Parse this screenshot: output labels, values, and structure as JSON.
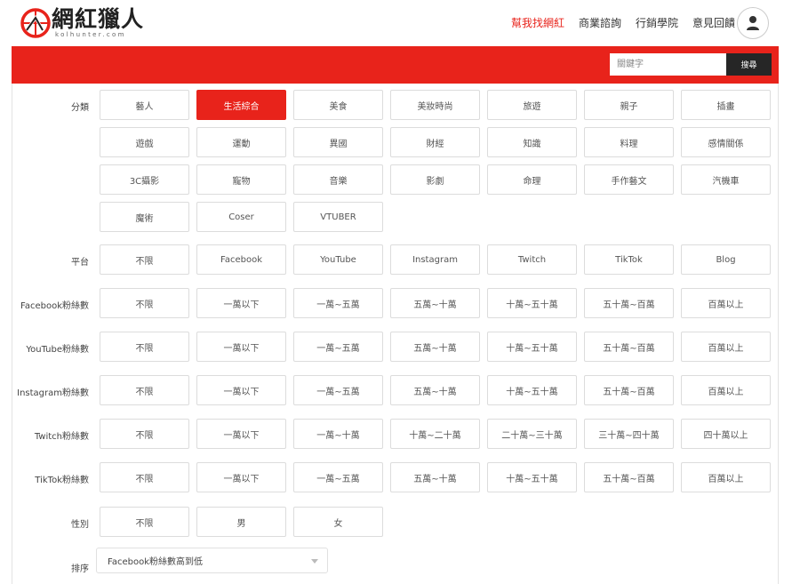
{
  "brand": {
    "name": "網紅獵人",
    "sub": "kolhunter.com"
  },
  "nav": [
    "幫我找網紅",
    "商業諮詢",
    "行銷學院",
    "意見回饋"
  ],
  "search": {
    "placeholder": "關鍵字",
    "button": "搜尋"
  },
  "colors": {
    "accent": "#e8231b",
    "button_dark": "#262626"
  },
  "filters": [
    {
      "label": "分類",
      "options": [
        "藝人",
        "生活綜合",
        "美食",
        "美妝時尚",
        "旅遊",
        "親子",
        "插畫",
        "遊戲",
        "運動",
        "異國",
        "財經",
        "知識",
        "料理",
        "感情關係",
        "3C攝影",
        "寵物",
        "音樂",
        "影劇",
        "命理",
        "手作藝文",
        "汽機車",
        "魔術",
        "Coser",
        "VTUBER"
      ],
      "selected": "生活綜合"
    },
    {
      "label": "平台",
      "options": [
        "不限",
        "Facebook",
        "YouTube",
        "Instagram",
        "Twitch",
        "TikTok",
        "Blog"
      ]
    },
    {
      "label": "Facebook粉絲數",
      "options": [
        "不限",
        "一萬以下",
        "一萬~五萬",
        "五萬~十萬",
        "十萬~五十萬",
        "五十萬~百萬",
        "百萬以上"
      ]
    },
    {
      "label": "YouTube粉絲數",
      "options": [
        "不限",
        "一萬以下",
        "一萬~五萬",
        "五萬~十萬",
        "十萬~五十萬",
        "五十萬~百萬",
        "百萬以上"
      ]
    },
    {
      "label": "Instagram粉絲數",
      "options": [
        "不限",
        "一萬以下",
        "一萬~五萬",
        "五萬~十萬",
        "十萬~五十萬",
        "五十萬~百萬",
        "百萬以上"
      ]
    },
    {
      "label": "Twitch粉絲數",
      "options": [
        "不限",
        "一萬以下",
        "一萬~十萬",
        "十萬~二十萬",
        "二十萬~三十萬",
        "三十萬~四十萬",
        "四十萬以上"
      ]
    },
    {
      "label": "TikTok粉絲數",
      "options": [
        "不限",
        "一萬以下",
        "一萬~五萬",
        "五萬~十萬",
        "十萬~五十萬",
        "五十萬~百萬",
        "百萬以上"
      ]
    },
    {
      "label": "性別",
      "options": [
        "不限",
        "男",
        "女"
      ]
    }
  ],
  "sort": {
    "label": "排序",
    "value": "Facebook粉絲數高到低"
  }
}
